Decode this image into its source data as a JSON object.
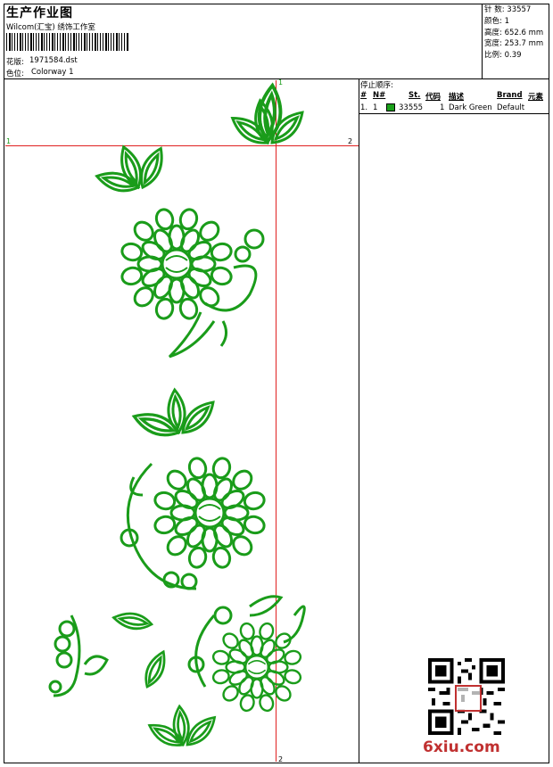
{
  "header": {
    "title": "生产作业图",
    "company": "Wilcom(汇宝) 绣饰工作室",
    "design_label": "花版:",
    "design_file": "1971584.dst",
    "colorway_label": "色位:",
    "colorway": "Colorway 1"
  },
  "stats": {
    "stitches_label": "针 数:",
    "stitches": "33557",
    "colors_label": "颜色:",
    "colors": "1",
    "height_label": "高度:",
    "height": "652.6 mm",
    "width_label": "宽度:",
    "width": "253.7 mm",
    "scale_label": "比例:",
    "scale": "0.39"
  },
  "stop_sequence": {
    "title": "停止顺序:",
    "columns": [
      "#",
      "N#",
      "St.",
      "代码",
      "描述",
      "Brand",
      "元素"
    ],
    "rows": [
      {
        "num": "1.",
        "needle": "1",
        "swatch_color": "#1aa01a",
        "stitches": "33555",
        "code": "1",
        "description": "Dark Green",
        "brand": "Default",
        "element": ""
      }
    ]
  },
  "guides": {
    "top_marker": "1",
    "bottom_marker": "2",
    "left_marker": "1",
    "right_marker": "2"
  },
  "watermark": "6xiu.com",
  "colors": {
    "thread": "#1a9c1a",
    "guide": "#e02020",
    "watermark": "#c03030"
  }
}
